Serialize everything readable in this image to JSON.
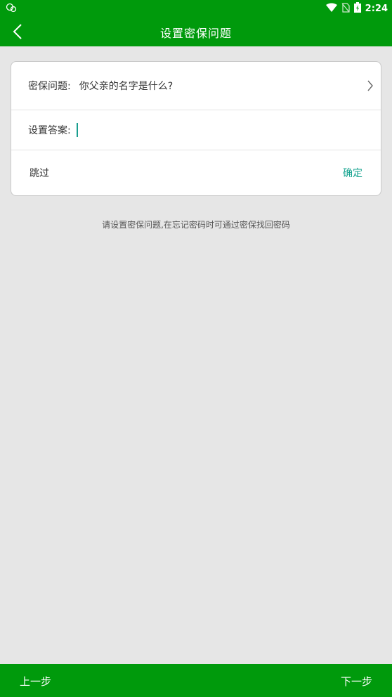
{
  "status_bar": {
    "time": "2:24",
    "icons": [
      "notification-icon",
      "wifi-icon",
      "no-sim-icon",
      "battery-charging-icon"
    ]
  },
  "app_bar": {
    "title": "设置密保问题",
    "back_icon": "back-arrow-icon"
  },
  "form": {
    "question_label": "密保问题:",
    "question_value": "你父亲的名字是什么?",
    "answer_label": "设置答案:",
    "answer_value": "",
    "skip_label": "跳过",
    "confirm_label": "确定"
  },
  "hint_text": "请设置密保问题,在忘记密码时可通过密保找回密码",
  "bottom_bar": {
    "prev_label": "上一步",
    "next_label": "下一步"
  },
  "colors": {
    "primary": "#009a0c",
    "accent": "#15a38f",
    "background": "#e6e6e6"
  }
}
